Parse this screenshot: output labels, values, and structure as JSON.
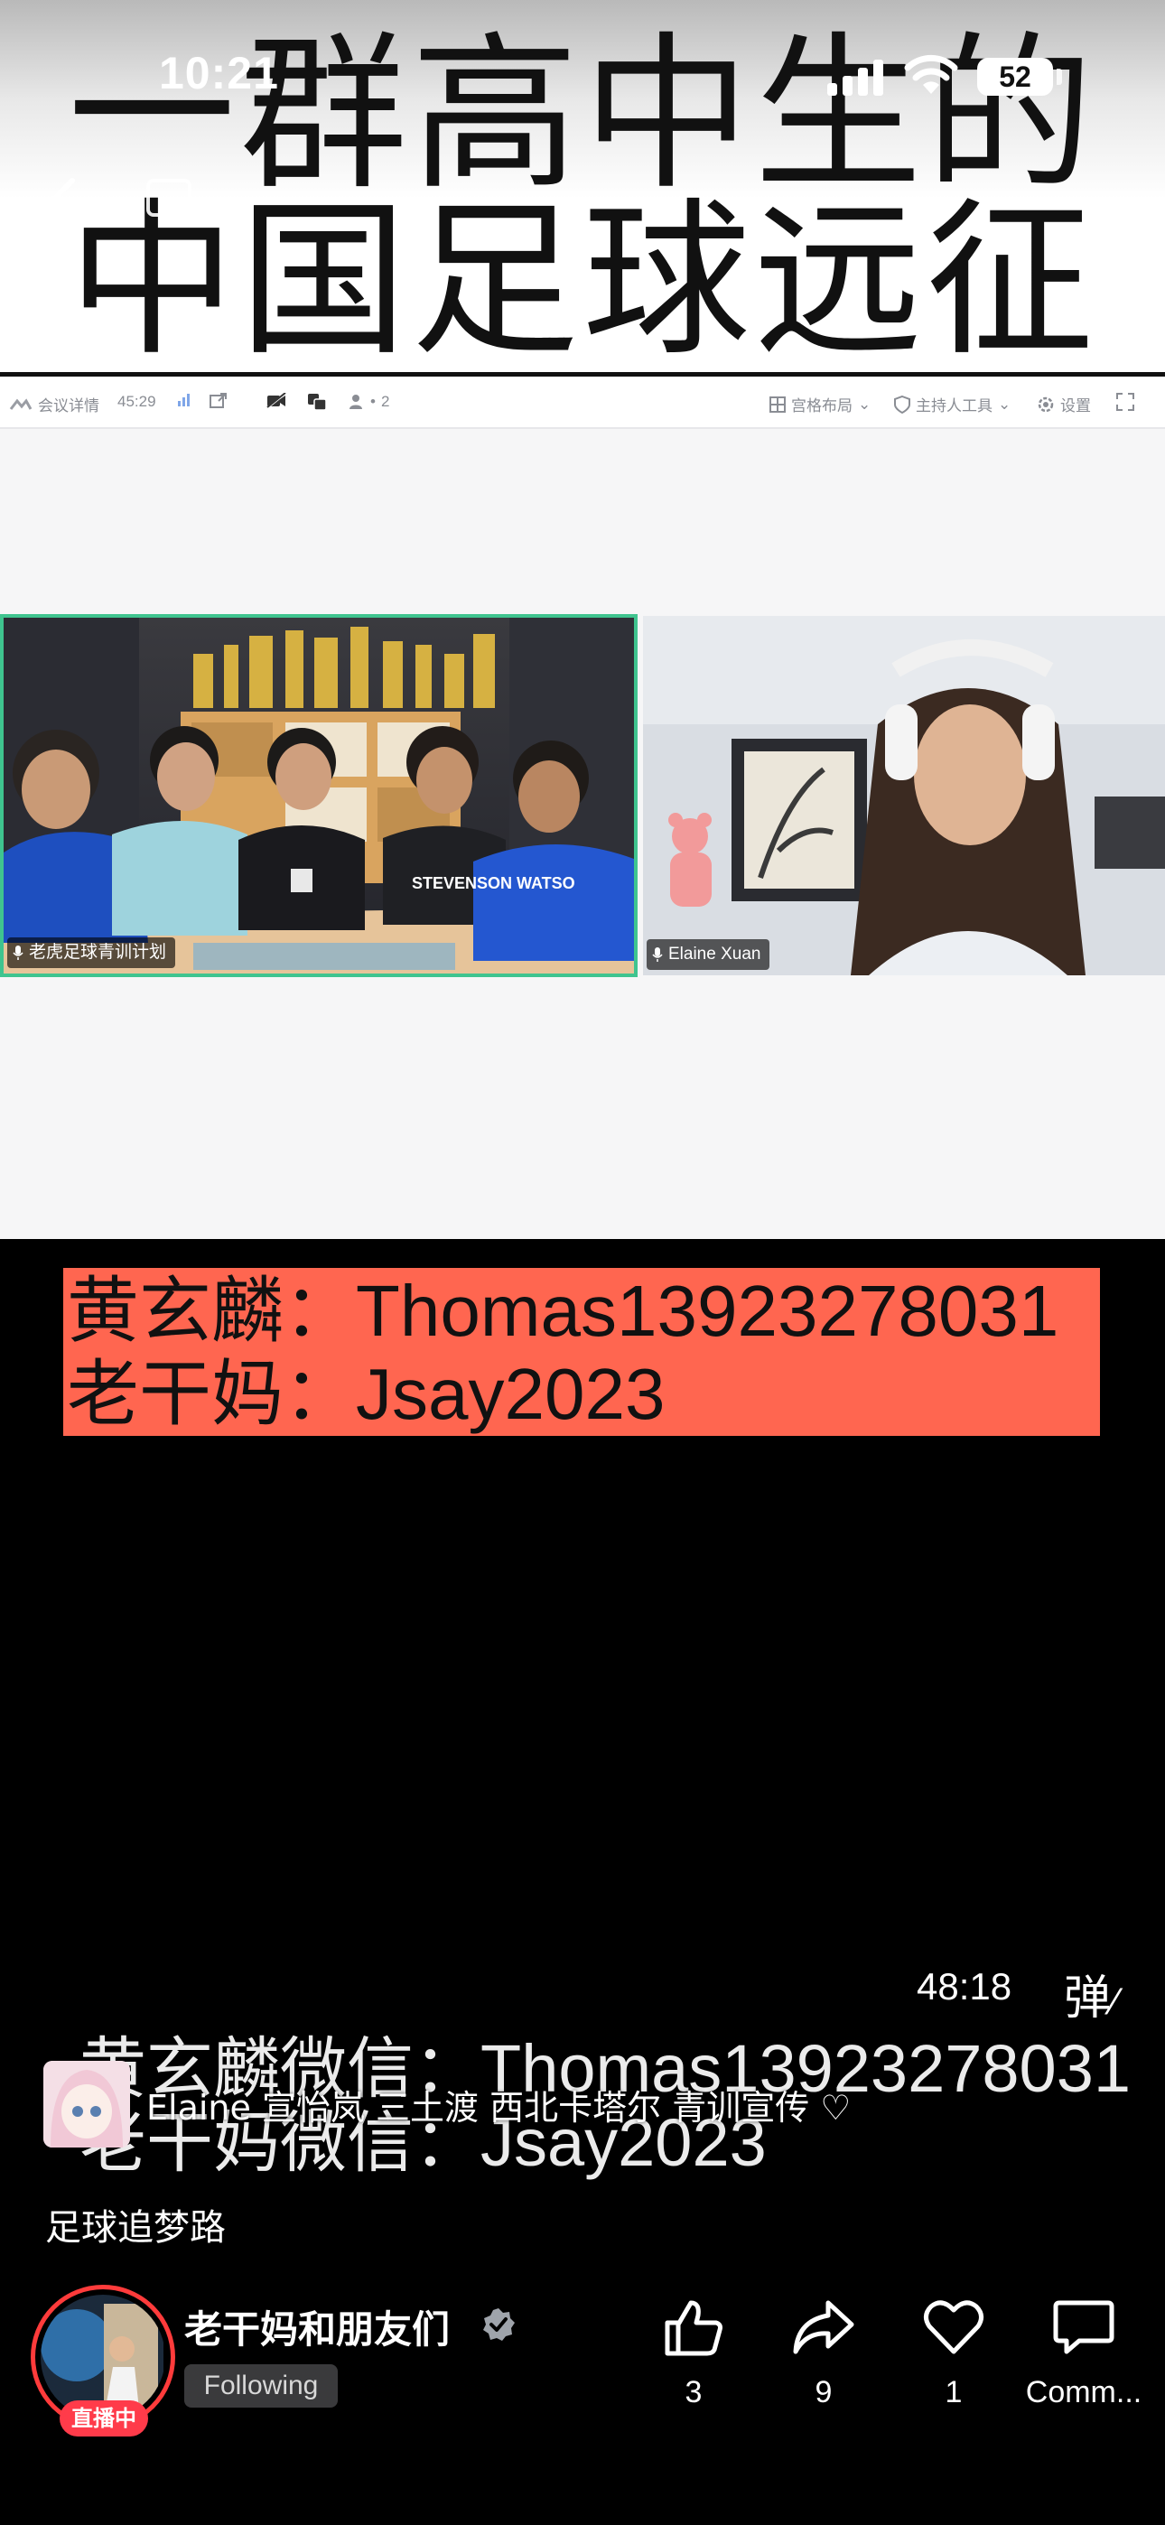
{
  "status_bar": {
    "time": "10:21",
    "battery": "52"
  },
  "video_title": {
    "line1": "一群高中生的",
    "line2": "中国足球远征"
  },
  "meeting_toolbar": {
    "details": "会议详情",
    "duration": "45:29",
    "participants": "2",
    "layout": "宫格布局",
    "host_tools": "主持人工具",
    "settings": "设置"
  },
  "video_tiles": [
    {
      "name": "老虎足球青训计划",
      "jersey_text": "STEVENSON WATSO"
    },
    {
      "name": "Elaine Xuan"
    }
  ],
  "contact_banner": {
    "line1_label": "黄玄麟：",
    "line1_value": "Thomas13923278031",
    "line2_label": "老干妈：",
    "line2_value": "Jsay2023"
  },
  "player": {
    "elapsed": "48:18",
    "danmu_label": "弹"
  },
  "ghost_caption": {
    "line1_label": "黄玄麟微信：",
    "line1_value": "Thomas13923278031",
    "line2_label": "老干妈微信：",
    "line2_value": "Jsay2023"
  },
  "comment": {
    "text": "Elaine 宣怡岚 三土渡 西北卡塔尔 青训宣传 ♡"
  },
  "caption": "足球追梦路",
  "host": {
    "name": "老干妈和朋友们",
    "live_badge": "直播中",
    "follow_state": "Following"
  },
  "actions": [
    {
      "icon": "thumbs-up-icon",
      "count": "3"
    },
    {
      "icon": "share-icon",
      "count": "9"
    },
    {
      "icon": "heart-icon",
      "count": "1"
    },
    {
      "icon": "comment-icon",
      "count": "Comm..."
    }
  ],
  "colors": {
    "banner_red": "#ff6650",
    "active_tile_border": "#3fc48f",
    "live_red": "#ff3b4a",
    "avatar_ring": "#ff3b3b"
  }
}
